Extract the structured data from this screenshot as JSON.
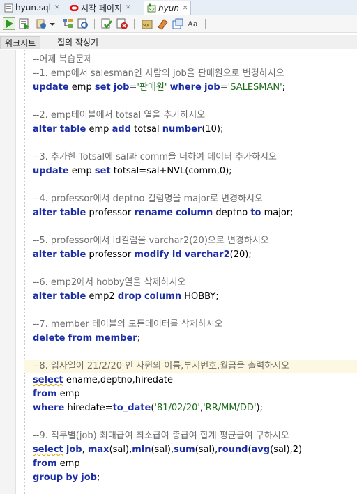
{
  "tabs": [
    {
      "label": "hyun.sql",
      "icon": "sql-file-icon"
    },
    {
      "label": "시작 페이지",
      "icon": "oracle-icon"
    },
    {
      "label": "hyun",
      "icon": "sql-worksheet-icon",
      "active": true
    }
  ],
  "toolbar_icons": [
    "run-statement-icon",
    "run-script-icon",
    "autotrace-icon",
    "dropdown-arrow-icon",
    "explain-plan-icon",
    "sql-tuning-icon",
    "commit-icon",
    "rollback-icon",
    "sql-history-icon",
    "clear-icon",
    "format-icon",
    "case-icon"
  ],
  "subtabs": [
    "워크시트",
    "질의 작성기"
  ],
  "code_lines": [
    [
      {
        "t": "--어제 복습문제",
        "c": "cm"
      }
    ],
    [
      {
        "t": "--1. emp에서 salesman인 사람의 job을 판매원으로 변경하시오",
        "c": "cm"
      }
    ],
    [
      {
        "t": "update",
        "c": "kw"
      },
      {
        "t": " emp ",
        "c": ""
      },
      {
        "t": "set",
        "c": "kw"
      },
      {
        "t": " ",
        "c": ""
      },
      {
        "t": "job",
        "c": "kw"
      },
      {
        "t": "=",
        "c": ""
      },
      {
        "t": "'판매원'",
        "c": "str"
      },
      {
        "t": " ",
        "c": ""
      },
      {
        "t": "where",
        "c": "kw"
      },
      {
        "t": " ",
        "c": ""
      },
      {
        "t": "job",
        "c": "kw"
      },
      {
        "t": "=",
        "c": ""
      },
      {
        "t": "'SALESMAN'",
        "c": "str"
      },
      {
        "t": ";",
        "c": ""
      }
    ],
    [],
    [
      {
        "t": "--2. emp테이블에서 totsal 열을 추가하시오",
        "c": "cm"
      }
    ],
    [
      {
        "t": "alter",
        "c": "kw"
      },
      {
        "t": " ",
        "c": ""
      },
      {
        "t": "table",
        "c": "kw"
      },
      {
        "t": " emp ",
        "c": ""
      },
      {
        "t": "add",
        "c": "kw"
      },
      {
        "t": " totsal ",
        "c": ""
      },
      {
        "t": "number",
        "c": "kw"
      },
      {
        "t": "(",
        "c": ""
      },
      {
        "t": "10",
        "c": "num"
      },
      {
        "t": ");",
        "c": ""
      }
    ],
    [],
    [
      {
        "t": "--3. 추가한 Totsal에 sal과 comm을 더하여 데이터 추가하시오",
        "c": "cm"
      }
    ],
    [
      {
        "t": "update",
        "c": "kw"
      },
      {
        "t": " emp ",
        "c": ""
      },
      {
        "t": "set",
        "c": "kw"
      },
      {
        "t": " totsal=sal+NVL(comm,",
        "c": ""
      },
      {
        "t": "0",
        "c": "num"
      },
      {
        "t": ");",
        "c": ""
      }
    ],
    [],
    [
      {
        "t": "--4. professor에서 deptno 컬럼명을 major로 변경하시오",
        "c": "cm"
      }
    ],
    [
      {
        "t": "alter",
        "c": "kw"
      },
      {
        "t": " ",
        "c": ""
      },
      {
        "t": "table",
        "c": "kw"
      },
      {
        "t": " professor ",
        "c": ""
      },
      {
        "t": "rename",
        "c": "kw"
      },
      {
        "t": " ",
        "c": ""
      },
      {
        "t": "column",
        "c": "kw"
      },
      {
        "t": " deptno ",
        "c": ""
      },
      {
        "t": "to",
        "c": "kw"
      },
      {
        "t": " major;",
        "c": ""
      }
    ],
    [],
    [
      {
        "t": "--5. professor에서 id컬럼을 varchar2(20)으로 변경하시오",
        "c": "cm"
      }
    ],
    [
      {
        "t": "alter",
        "c": "kw"
      },
      {
        "t": " ",
        "c": ""
      },
      {
        "t": "table",
        "c": "kw"
      },
      {
        "t": " professor ",
        "c": ""
      },
      {
        "t": "modify",
        "c": "kw"
      },
      {
        "t": " ",
        "c": ""
      },
      {
        "t": "id",
        "c": "kw"
      },
      {
        "t": " ",
        "c": ""
      },
      {
        "t": "varchar2",
        "c": "kw"
      },
      {
        "t": "(",
        "c": ""
      },
      {
        "t": "20",
        "c": "num"
      },
      {
        "t": ");",
        "c": ""
      }
    ],
    [],
    [
      {
        "t": "--6. emp2에서 hobby열을 삭제하시오",
        "c": "cm"
      }
    ],
    [
      {
        "t": "alter",
        "c": "kw"
      },
      {
        "t": " ",
        "c": ""
      },
      {
        "t": "table",
        "c": "kw"
      },
      {
        "t": " emp2 ",
        "c": ""
      },
      {
        "t": "drop",
        "c": "kw"
      },
      {
        "t": " ",
        "c": ""
      },
      {
        "t": "column",
        "c": "kw"
      },
      {
        "t": " HOBBY;",
        "c": ""
      }
    ],
    [],
    [
      {
        "t": "--7. member 테이블의 모든데이터를 삭제하시오",
        "c": "cm"
      }
    ],
    [
      {
        "t": "delete",
        "c": "kw"
      },
      {
        "t": " ",
        "c": ""
      },
      {
        "t": "from",
        "c": "kw"
      },
      {
        "t": " ",
        "c": ""
      },
      {
        "t": "member",
        "c": "kw"
      },
      {
        "t": ";",
        "c": ""
      }
    ],
    [],
    [
      {
        "t": "--8. 입사일이 21/2/20 인 사원의 이름,부서번호,월급을 출력하시오",
        "c": "cm"
      }
    ],
    [
      {
        "t": "select",
        "c": "kw wavy"
      },
      {
        "t": " ename,deptno,hiredate",
        "c": ""
      }
    ],
    [
      {
        "t": "from",
        "c": "kw"
      },
      {
        "t": " emp",
        "c": ""
      }
    ],
    [
      {
        "t": "where",
        "c": "kw"
      },
      {
        "t": " hiredate=",
        "c": ""
      },
      {
        "t": "to_date",
        "c": "fn"
      },
      {
        "t": "(",
        "c": ""
      },
      {
        "t": "'81/02/20'",
        "c": "str"
      },
      {
        "t": ",",
        "c": ""
      },
      {
        "t": "'RR/MM/DD'",
        "c": "str"
      },
      {
        "t": ");",
        "c": ""
      }
    ],
    [],
    [
      {
        "t": "--9. 직무별(job) 최대급여 최소급여 총급여 합계 평균급여 구하시오",
        "c": "cm"
      }
    ],
    [
      {
        "t": "select",
        "c": "kw wavy"
      },
      {
        "t": " ",
        "c": ""
      },
      {
        "t": "job",
        "c": "kw"
      },
      {
        "t": ", ",
        "c": ""
      },
      {
        "t": "max",
        "c": "fn"
      },
      {
        "t": "(sal),",
        "c": ""
      },
      {
        "t": "min",
        "c": "fn"
      },
      {
        "t": "(sal),",
        "c": ""
      },
      {
        "t": "sum",
        "c": "fn"
      },
      {
        "t": "(sal),",
        "c": ""
      },
      {
        "t": "round",
        "c": "fn"
      },
      {
        "t": "(",
        "c": ""
      },
      {
        "t": "avg",
        "c": "fn"
      },
      {
        "t": "(sal),",
        "c": ""
      },
      {
        "t": "2",
        "c": "num"
      },
      {
        "t": ")",
        "c": ""
      }
    ],
    [
      {
        "t": "from",
        "c": "kw"
      },
      {
        "t": " emp",
        "c": ""
      }
    ],
    [
      {
        "t": "group",
        "c": "kw"
      },
      {
        "t": " ",
        "c": ""
      },
      {
        "t": "by",
        "c": "kw"
      },
      {
        "t": " ",
        "c": ""
      },
      {
        "t": "job",
        "c": "kw"
      },
      {
        "t": ";",
        "c": ""
      }
    ]
  ],
  "highlight_line": 22
}
